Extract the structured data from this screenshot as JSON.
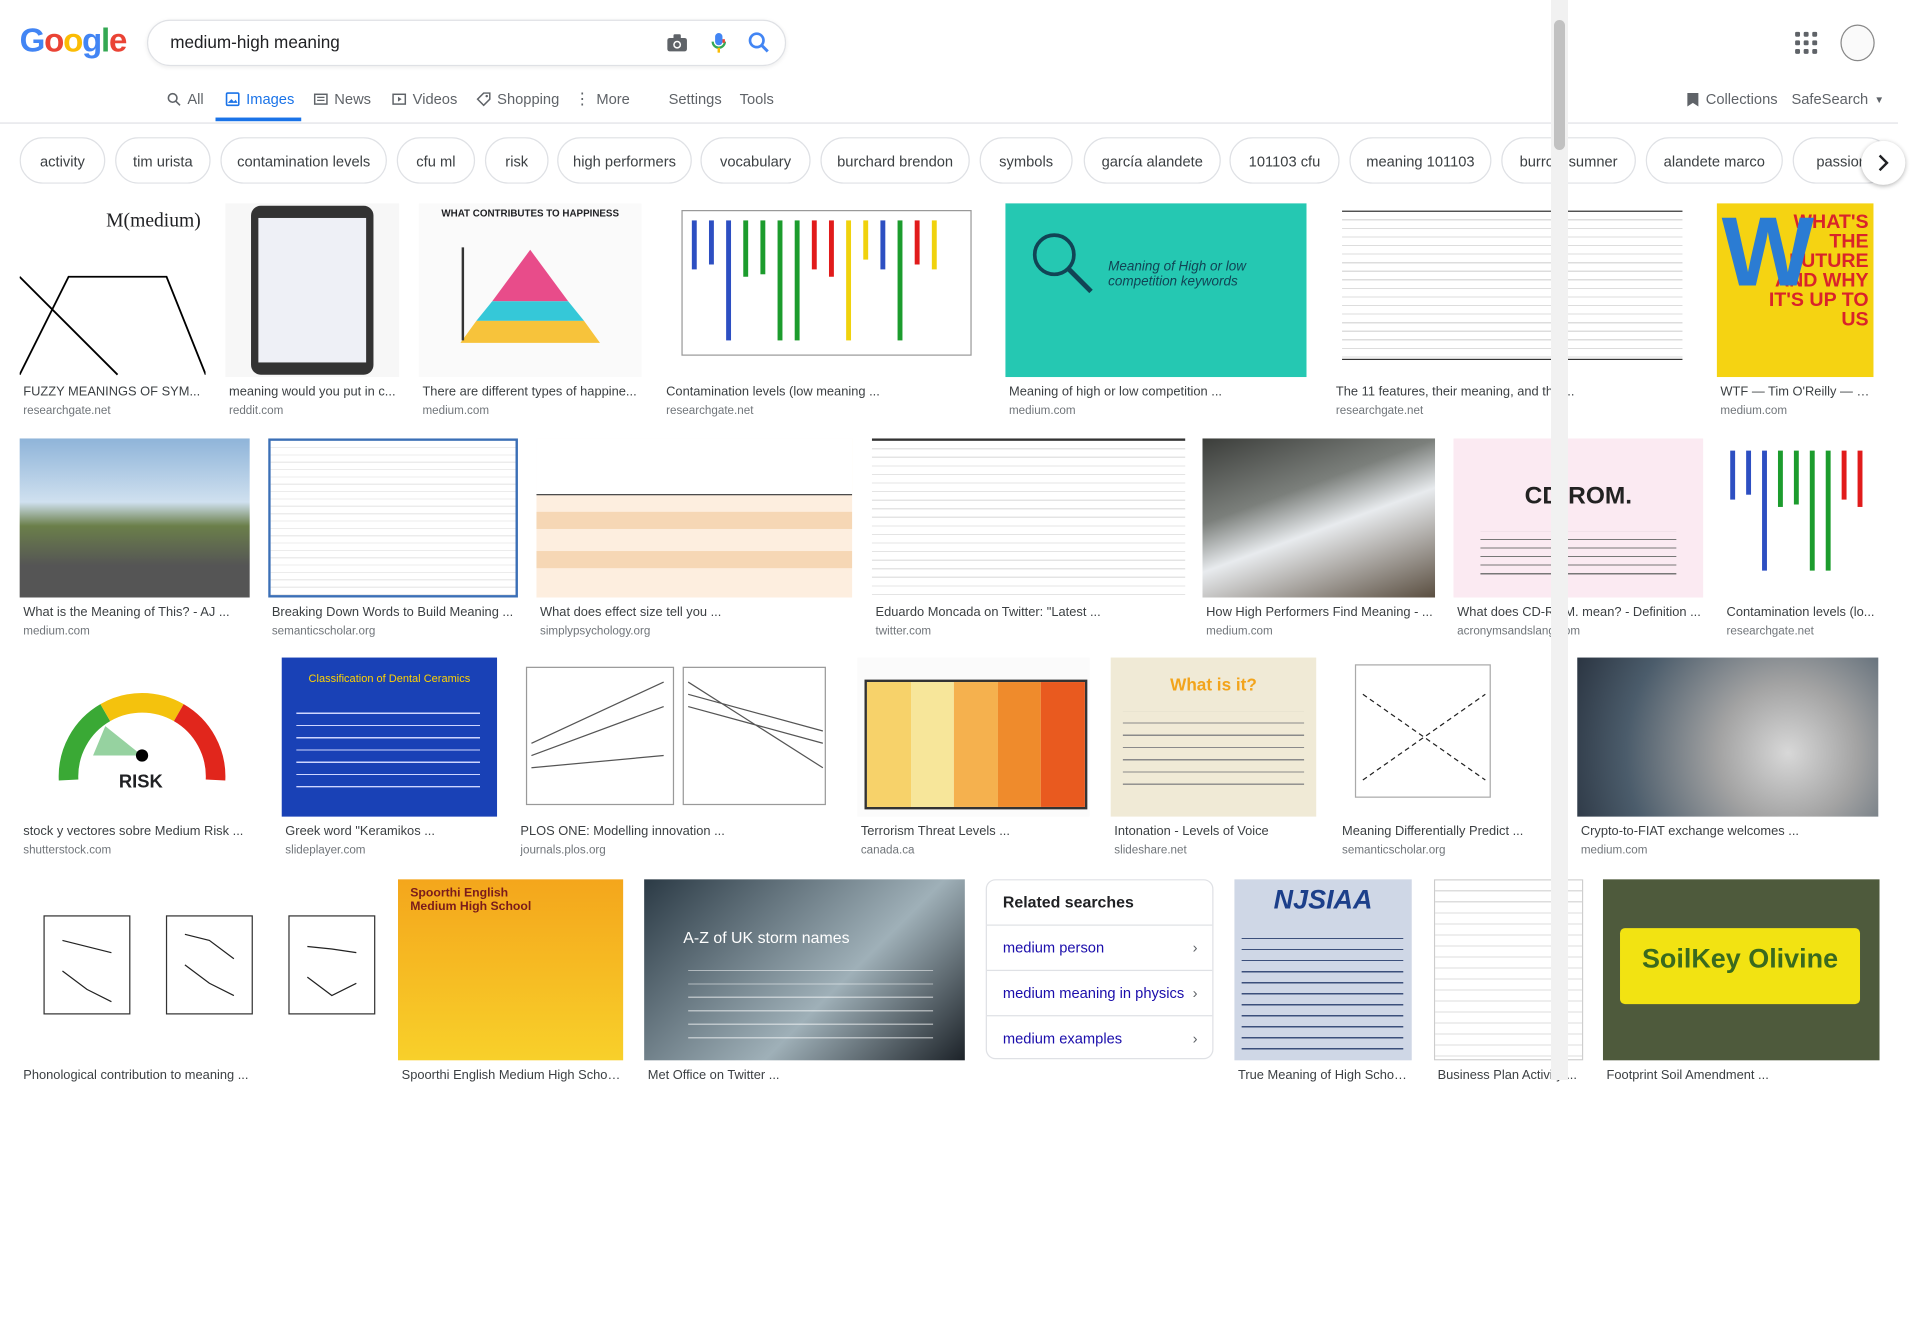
{
  "logo": "Google",
  "colors": {
    "accent": "#1a73e8",
    "link": "#1a0dab",
    "blue": "#4285F4",
    "red": "#EA4335",
    "yellow": "#FBBC05",
    "green": "#34A853"
  },
  "search": {
    "query": "medium-high meaning",
    "icons": [
      "camera-icon",
      "mic-icon",
      "search-icon"
    ]
  },
  "tabs": [
    {
      "label": "All",
      "icon": "search-icon"
    },
    {
      "label": "Images",
      "icon": "image-icon",
      "active": true
    },
    {
      "label": "News",
      "icon": "news-icon"
    },
    {
      "label": "Videos",
      "icon": "video-icon"
    },
    {
      "label": "Shopping",
      "icon": "tag-icon"
    },
    {
      "label": "More",
      "icon": "more-icon"
    },
    {
      "label": "Settings"
    },
    {
      "label": "Tools"
    }
  ],
  "header_right": {
    "collections": "Collections",
    "safesearch": "SafeSearch"
  },
  "chips": [
    "activity",
    "tim urista",
    "contamination levels",
    "cfu ml",
    "risk",
    "high performers",
    "vocabulary",
    "burchard brendon",
    "symbols",
    "garcía alandete",
    "101103 cfu",
    "meaning 101103",
    "burrow sumner",
    "alandete marco",
    "passion"
  ],
  "results": [
    {
      "caption": "FUZZY MEANINGS OF SYM...",
      "source": "researchgate.net",
      "thumb_text": "M(medium)"
    },
    {
      "caption": "meaning would you put in c...",
      "source": "reddit.com"
    },
    {
      "caption": "There are different types of happine...",
      "source": "medium.com",
      "thumb_text": "WHAT CONTRIBUTES TO HAPPINESS"
    },
    {
      "caption": "Contamination levels (low meaning ...",
      "source": "researchgate.net"
    },
    {
      "caption": "Meaning of high or low competition ...",
      "source": "medium.com",
      "thumb_text": "Meaning of High or low competition keywords"
    },
    {
      "caption": "The 11 features, their meaning, and the ...",
      "source": "researchgate.net"
    },
    {
      "caption": "WTF — Tim O'Reilly — Lig...",
      "source": "medium.com",
      "thumb_text": "WHAT'S THE FUTURE AND WHY IT'S UP TO US"
    },
    {
      "caption": "What is the Meaning of This? - AJ ...",
      "source": "medium.com"
    },
    {
      "caption": "Breaking Down Words to Build Meaning ...",
      "source": "semanticscholar.org"
    },
    {
      "caption": "What does effect size tell you ...",
      "source": "simplypsychology.org"
    },
    {
      "caption": "Eduardo Moncada on Twitter: \"Latest ...",
      "source": "twitter.com"
    },
    {
      "caption": "How High Performers Find Meaning - ...",
      "source": "medium.com"
    },
    {
      "caption": "What does CD-ROM. mean? - Definition ...",
      "source": "acronymsandslang.com",
      "thumb_text": "CD-ROM."
    },
    {
      "caption": "Contamination levels (lo...",
      "source": "researchgate.net"
    },
    {
      "caption": "stock y vectores sobre Medium Risk ...",
      "source": "shutterstock.com",
      "thumb_text": "RISK"
    },
    {
      "caption": "Greek word \"Keramikos ...",
      "source": "slideplayer.com",
      "thumb_text": "Classification of Dental Ceramics"
    },
    {
      "caption": "PLOS ONE: Modelling innovation ...",
      "source": "journals.plos.org"
    },
    {
      "caption": "Terrorism Threat Levels ...",
      "source": "canada.ca"
    },
    {
      "caption": "Intonation - Levels of Voice",
      "source": "slideshare.net",
      "thumb_text": "What is it?"
    },
    {
      "caption": "Meaning Differentially Predict ...",
      "source": "semanticscholar.org"
    },
    {
      "caption": "Crypto-to-FIAT exchange welcomes ...",
      "source": "medium.com"
    },
    {
      "caption": "Phonological contribution to meaning ...",
      "source": ""
    },
    {
      "caption": "Spoorthi English Medium High Schoo...",
      "source": "",
      "thumb_text": "Spoorthi English Medium High School"
    },
    {
      "caption": "Met Office on Twitter ...",
      "source": "",
      "thumb_text": "A-Z of UK storm names"
    },
    {
      "caption": "True Meaning of High School...",
      "source": "",
      "thumb_text": "NJSIAA"
    },
    {
      "caption": "Business Plan Activity ...",
      "source": ""
    },
    {
      "caption": "Footprint Soil Amendment ...",
      "source": "",
      "thumb_text": "SoilKey Olivine"
    }
  ],
  "related": {
    "title": "Related searches",
    "items": [
      "medium person",
      "medium meaning in physics",
      "medium examples"
    ]
  }
}
